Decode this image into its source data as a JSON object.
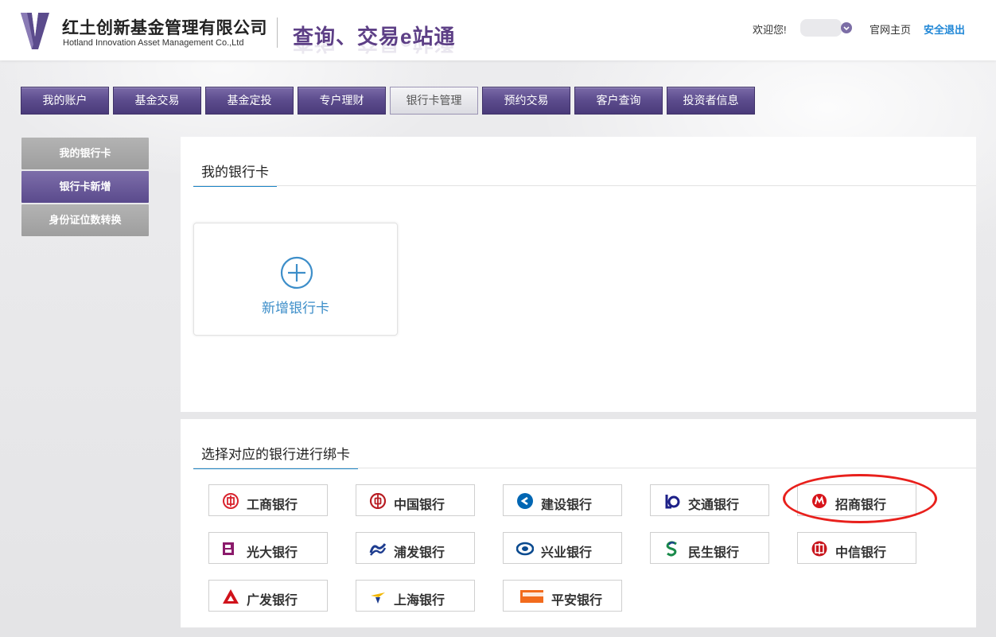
{
  "header": {
    "company_cn": "红土创新基金管理有限公司",
    "company_en": "Hotland Innovation Asset Management Co.,Ltd",
    "slogan": "查询、交易e站通",
    "welcome": "欢迎您!",
    "home_link": "官网主页",
    "logout_link": "安全退出"
  },
  "nav": {
    "items": [
      "我的账户",
      "基金交易",
      "基金定投",
      "专户理财",
      "银行卡管理",
      "预约交易",
      "客户查询",
      "投资者信息"
    ],
    "active": "银行卡管理"
  },
  "side": {
    "items": [
      "我的银行卡",
      "银行卡新增",
      "身份证位数转换"
    ],
    "active": "银行卡新增"
  },
  "my_cards": {
    "title": "我的银行卡",
    "add_label": "新增银行卡"
  },
  "bind": {
    "title": "选择对应的银行进行绑卡",
    "banks": [
      {
        "name": "工商银行",
        "icon": "icbc-icon",
        "color": "#d9232d"
      },
      {
        "name": "中国银行",
        "icon": "boc-icon",
        "color": "#b81c22"
      },
      {
        "name": "建设银行",
        "icon": "ccb-icon",
        "color": "#0066b3"
      },
      {
        "name": "交通银行",
        "icon": "bocom-icon",
        "color": "#1d2088"
      },
      {
        "name": "招商银行",
        "icon": "cmb-icon",
        "color": "#d7141a"
      },
      {
        "name": "光大银行",
        "icon": "ceb-icon",
        "color": "#8b1a6b"
      },
      {
        "name": "浦发银行",
        "icon": "spdb-icon",
        "color": "#1d3c8f"
      },
      {
        "name": "兴业银行",
        "icon": "cib-icon",
        "color": "#0a4a8f"
      },
      {
        "name": "民生银行",
        "icon": "cmbc-icon",
        "color": "#1a8a4a"
      },
      {
        "name": "中信银行",
        "icon": "citic-icon",
        "color": "#c8161d"
      },
      {
        "name": "广发银行",
        "icon": "cgb-icon",
        "color": "#d0121b"
      },
      {
        "name": "上海银行",
        "icon": "bos-icon",
        "color": "#f2b705"
      },
      {
        "name": "平安银行",
        "icon": "pingan-icon",
        "color": "#f26b1d"
      }
    ]
  },
  "colors": {
    "brand_purple": "#5b4b8c",
    "accent_blue": "#1d86c8",
    "highlight_red": "#e8201c"
  }
}
